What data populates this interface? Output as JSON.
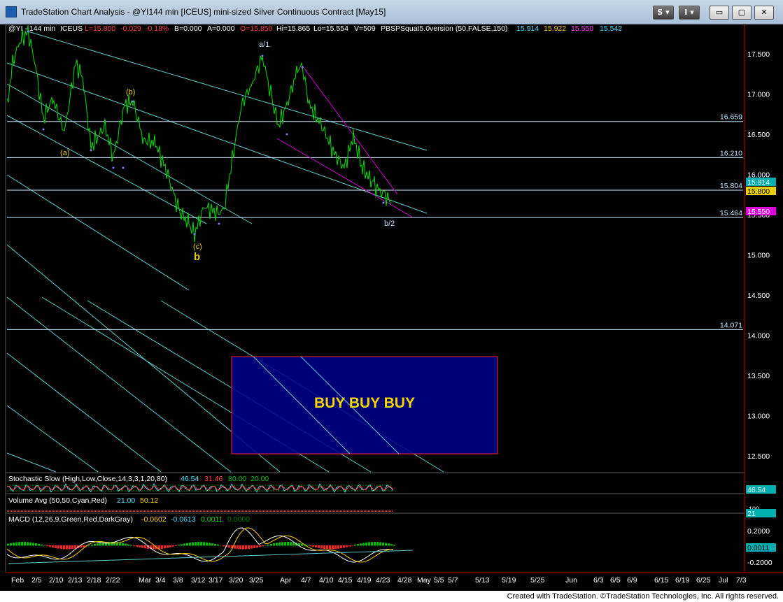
{
  "window": {
    "title": "TradeStation Chart Analysis - @YI144 min [ICEUS] mini-sized Silver Continuous Contract [May15]",
    "btn_s": "S",
    "btn_i": "I",
    "btn_min": "▭",
    "btn_max": "▢",
    "btn_close": "✕"
  },
  "header": {
    "symbol": "@YI - 144 min",
    "exchange": "ICEUS",
    "last": "L=15.800",
    "change": "-0.029",
    "change_pct": "-0.18%",
    "bid": "B=0.000",
    "ask": "A=0.000",
    "open": "O=15.850",
    "high": "Hi=15.865",
    "low": "Lo=15.554",
    "volume": "V=509",
    "study": "PBSPSquat5.0version (50,FALSE,150)",
    "v1": "15.914",
    "v2": "15.922",
    "v3": "15.550",
    "v4": "15.542"
  },
  "colors": {
    "price": "#00e000",
    "channel": "#66cccc",
    "wedge": "#d000d0",
    "label_yellow": "#e8d000",
    "label_white": "#c8d8ff",
    "buy_box_fill": "#00008b",
    "buy_box_border": "#ff2222",
    "axis_text": "#ffffff"
  },
  "price_axis": {
    "ticks": [
      "17.500",
      "17.000",
      "16.500",
      "16.000",
      "15.500",
      "15.000",
      "14.500",
      "14.000",
      "13.500",
      "13.000",
      "12.500"
    ]
  },
  "levels": [
    {
      "label": "16.659",
      "value": 16.659
    },
    {
      "label": "16.210",
      "value": 16.21
    },
    {
      "label": "15.804",
      "value": 15.804
    },
    {
      "label": "15.464",
      "value": 15.464
    },
    {
      "label": "14.071",
      "value": 14.071
    }
  ],
  "axis_tags": {
    "t1": "15.914",
    "t2": "15.800",
    "t3": "15.550",
    "stoch": "46.54",
    "vol": "21",
    "macd": "0.0011"
  },
  "wave_labels": {
    "a": "(a)",
    "b_small": "(b)",
    "c": "(c)",
    "b_big": "b",
    "a1": "a/1",
    "b2": "b/2"
  },
  "buy_box": {
    "text": "BUY BUY BUY"
  },
  "stochastic": {
    "title": "Stochastic Slow (High,Low,Close,14,3,3,1,20,80)",
    "v1": "46.54",
    "v2": "31.46",
    "v3": "80.00",
    "v4": "20.00"
  },
  "volume_avg": {
    "title": "Volume Avg (50,50,Cyan,Red)",
    "v1": "21.00",
    "v2": "50.12",
    "axis_label": "100"
  },
  "macd": {
    "title": "MACD (12,26,9,Green,Red,DarkGray)",
    "v1": "-0.0602",
    "v2": "-0.0613",
    "v3": "0.0011",
    "v4": "0.0000",
    "ticks": [
      "0.2000",
      "0.0000",
      "-0.2000"
    ]
  },
  "time_axis": [
    "Feb",
    "2/5",
    "2/10",
    "2/13",
    "2/18",
    "2/22",
    "Mar",
    "3/4",
    "3/8",
    "3/12",
    "3/17",
    "3/20",
    "3/25",
    "Apr",
    "4/7",
    "4/10",
    "4/15",
    "4/19",
    "4/23",
    "4/28",
    "May",
    "5/5",
    "5/7",
    "5/13",
    "5/19",
    "5/25",
    "Jun",
    "6/3",
    "6/5",
    "6/9",
    "6/15",
    "6/19",
    "6/25",
    "Jul",
    "7/3"
  ],
  "footer": {
    "text": "Created with TradeStation. ©TradeStation Technologies, Inc. All rights reserved."
  }
}
